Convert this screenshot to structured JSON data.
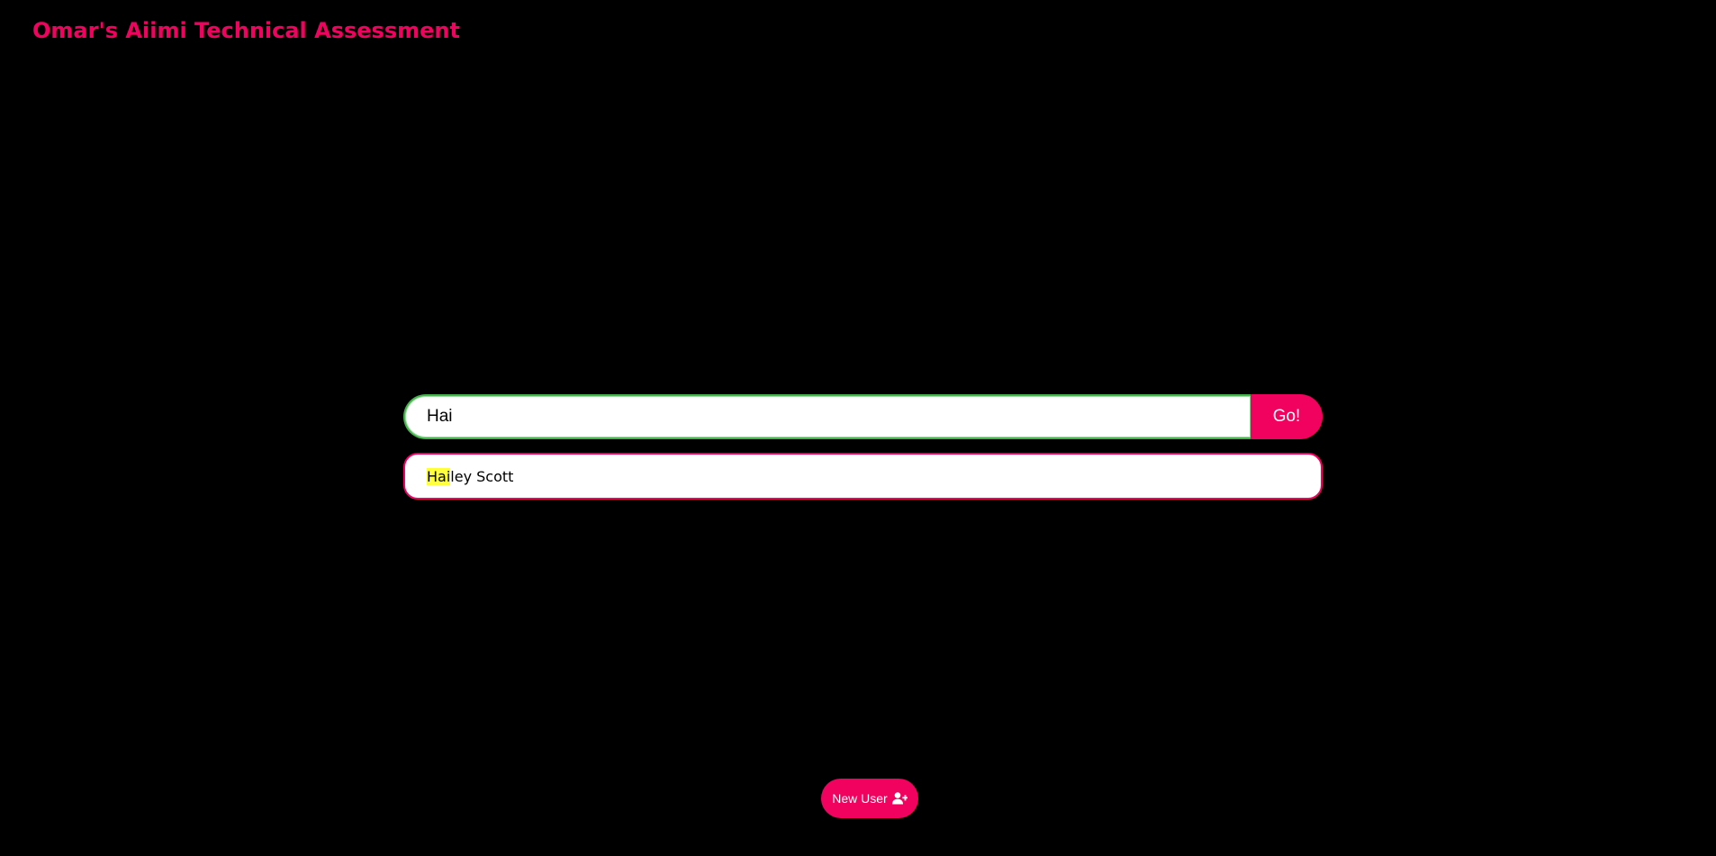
{
  "app": {
    "title": "Omar's Aiimi Technical Assessment"
  },
  "search": {
    "value": "Hai",
    "go_label": "Go!"
  },
  "suggestions": [
    {
      "match": "Hai",
      "rest": "ley Scott"
    }
  ],
  "actions": {
    "new_user_label": "New User",
    "new_user_icon": "user-plus-icon"
  },
  "colors": {
    "accent": "#f0025e",
    "focus_border": "#43b54a",
    "highlight": "#ffff3b",
    "background": "#000000"
  }
}
